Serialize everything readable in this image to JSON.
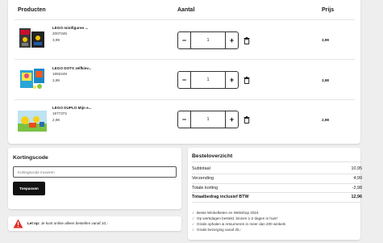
{
  "cart": {
    "headers": {
      "products": "Producten",
      "quantity": "Aantal",
      "price": "Prijs"
    },
    "items": [
      {
        "name": "LEGO minifiguren ...",
        "sku": "2007345",
        "unit_price": "3,99",
        "qty": "1",
        "line_price": "3,99"
      },
      {
        "name": "LEGO DOTS zelfkiev...",
        "sku": "1992249",
        "unit_price": "3,98",
        "qty": "1",
        "line_price": "3,98"
      },
      {
        "name": "LEGO DUPLO Mijn e...",
        "sku": "1977372",
        "unit_price": "2,98",
        "qty": "1",
        "line_price": "2,98"
      }
    ],
    "minus_symbol": "−",
    "plus_symbol": "+"
  },
  "coupon": {
    "title": "Kortingscode",
    "placeholder": "Kortingscode invoeren",
    "apply_label": "Toepassen"
  },
  "alert": {
    "bold": "Let op:",
    "text": "Je kunt online alleen bestellen vanaf 10,-"
  },
  "summary": {
    "title": "Besteloverzicht",
    "rows": [
      {
        "label": "Subtotaal",
        "value": "10,95"
      },
      {
        "label": "Verzending",
        "value": "4,99"
      },
      {
        "label": "Totale korting",
        "value": "-2,98"
      }
    ],
    "total": {
      "label": "Totaalbedrag inclusief BTW",
      "value": "12,96"
    },
    "benefits": [
      "Beste Winkelketen en Webshop 2024",
      "Op werkdagen besteld, binnen 1-2 dagen in huis*",
      "Gratis ophalen & retourneren in meer dan 200 winkels",
      "Gratis bezorging vanaf 25,-"
    ]
  },
  "colors": {
    "accent_button": "#111111",
    "alert_red": "#e0302a",
    "background": "#eeeeee"
  },
  "icons": {
    "trash": "trash-icon",
    "alert": "warning-icon",
    "check": "check-icon"
  }
}
